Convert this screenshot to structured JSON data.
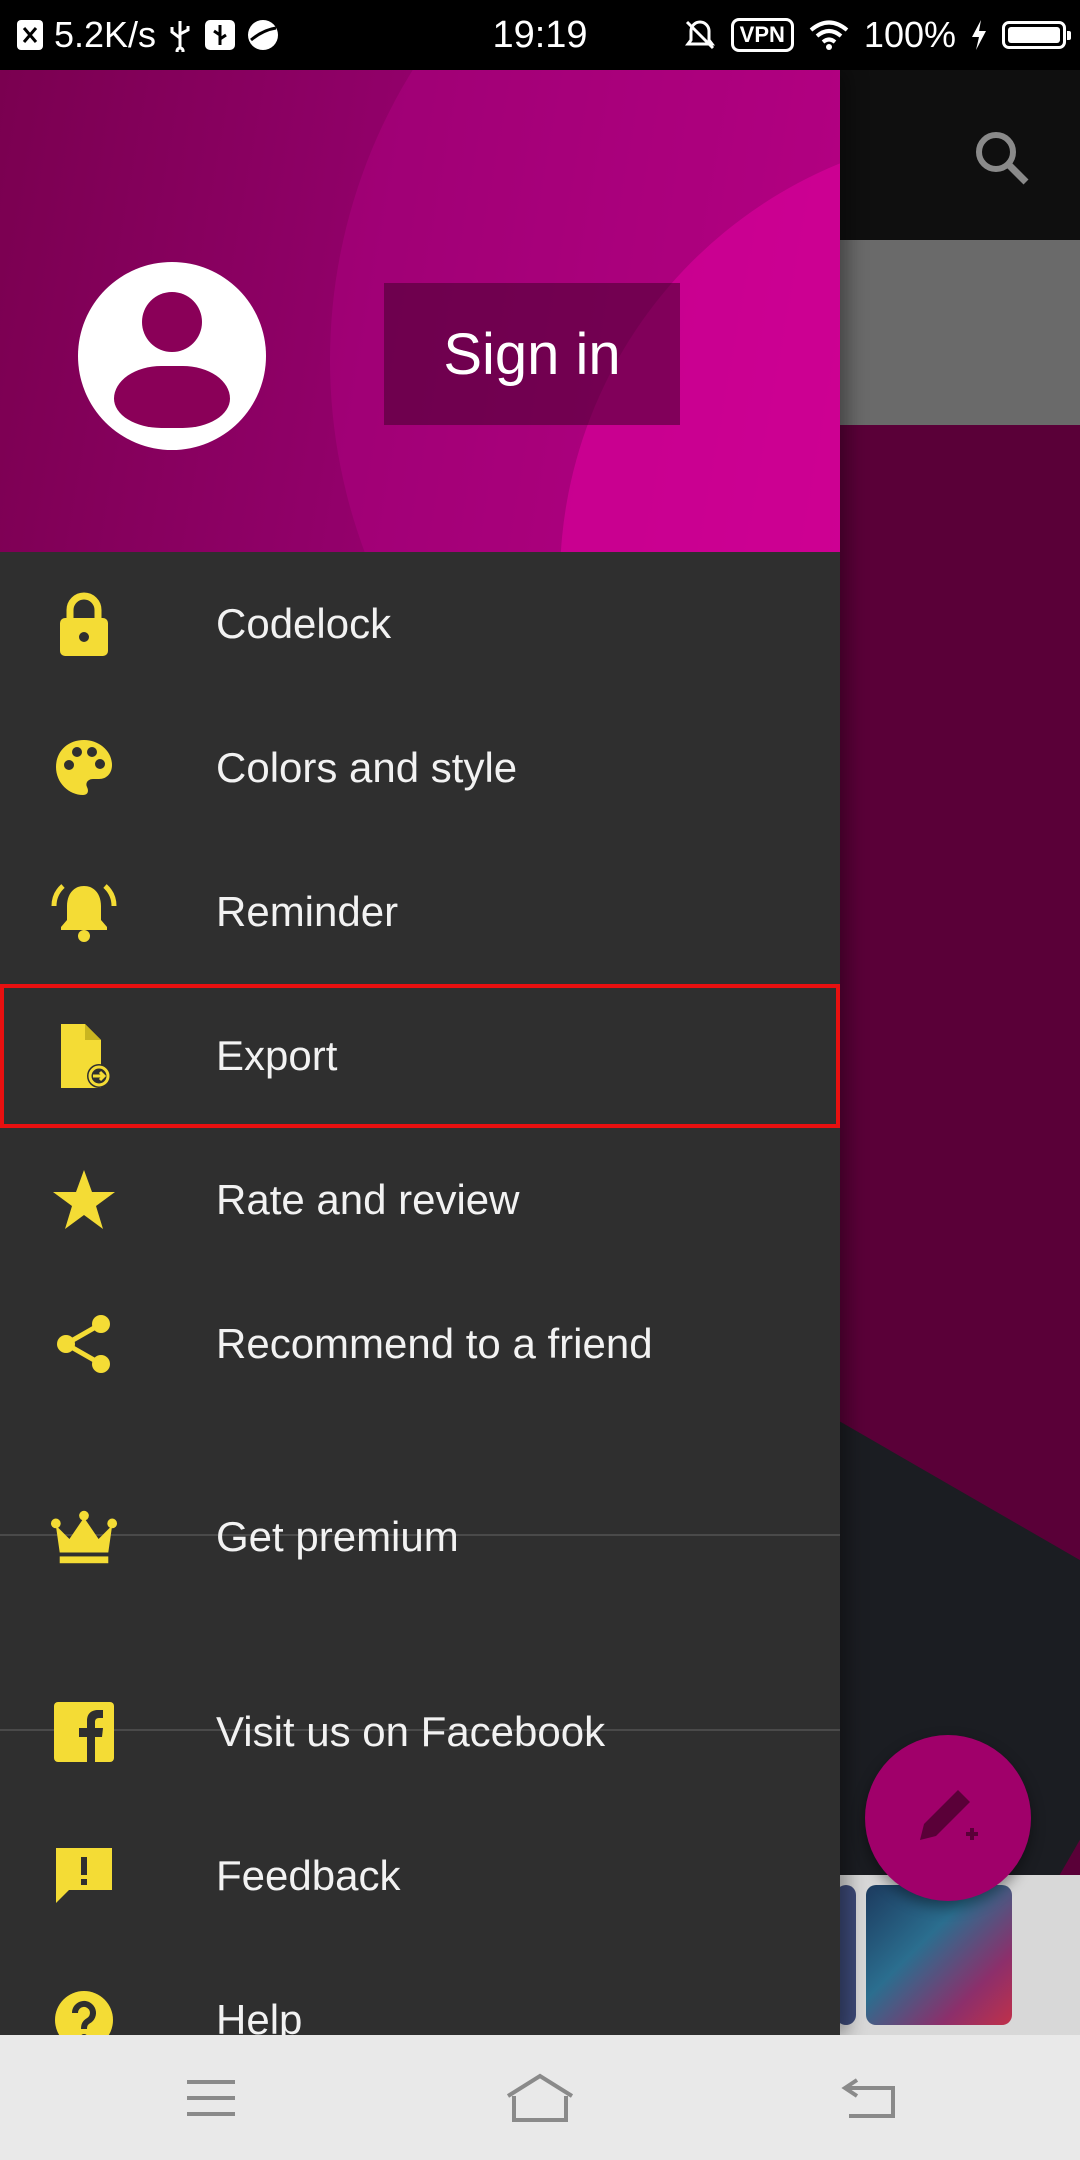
{
  "status_bar": {
    "speed": "5.2K/s",
    "time": "19:19",
    "vpn": "VPN",
    "battery": "100%"
  },
  "header": {
    "sign_in_label": "Sign in"
  },
  "menu": {
    "items": [
      {
        "label": "Codelock",
        "icon": "lock-icon"
      },
      {
        "label": "Colors and style",
        "icon": "palette-icon"
      },
      {
        "label": "Reminder",
        "icon": "alarm-bell-icon"
      },
      {
        "label": "Export",
        "icon": "export-file-icon"
      },
      {
        "label": "Rate and review",
        "icon": "star-icon"
      },
      {
        "label": "Recommend to a friend",
        "icon": "share-icon"
      },
      {
        "label": "Get premium",
        "icon": "crown-icon"
      },
      {
        "label": "Visit us on Facebook",
        "icon": "facebook-icon"
      },
      {
        "label": "Feedback",
        "icon": "feedback-icon"
      },
      {
        "label": "Help",
        "icon": "help-icon"
      }
    ]
  },
  "colors": {
    "accent_icon": "#f4dc35",
    "drawer_bg": "#2f2f2f",
    "header_magenta": "#92006a",
    "highlight_outline": "#e81010"
  }
}
